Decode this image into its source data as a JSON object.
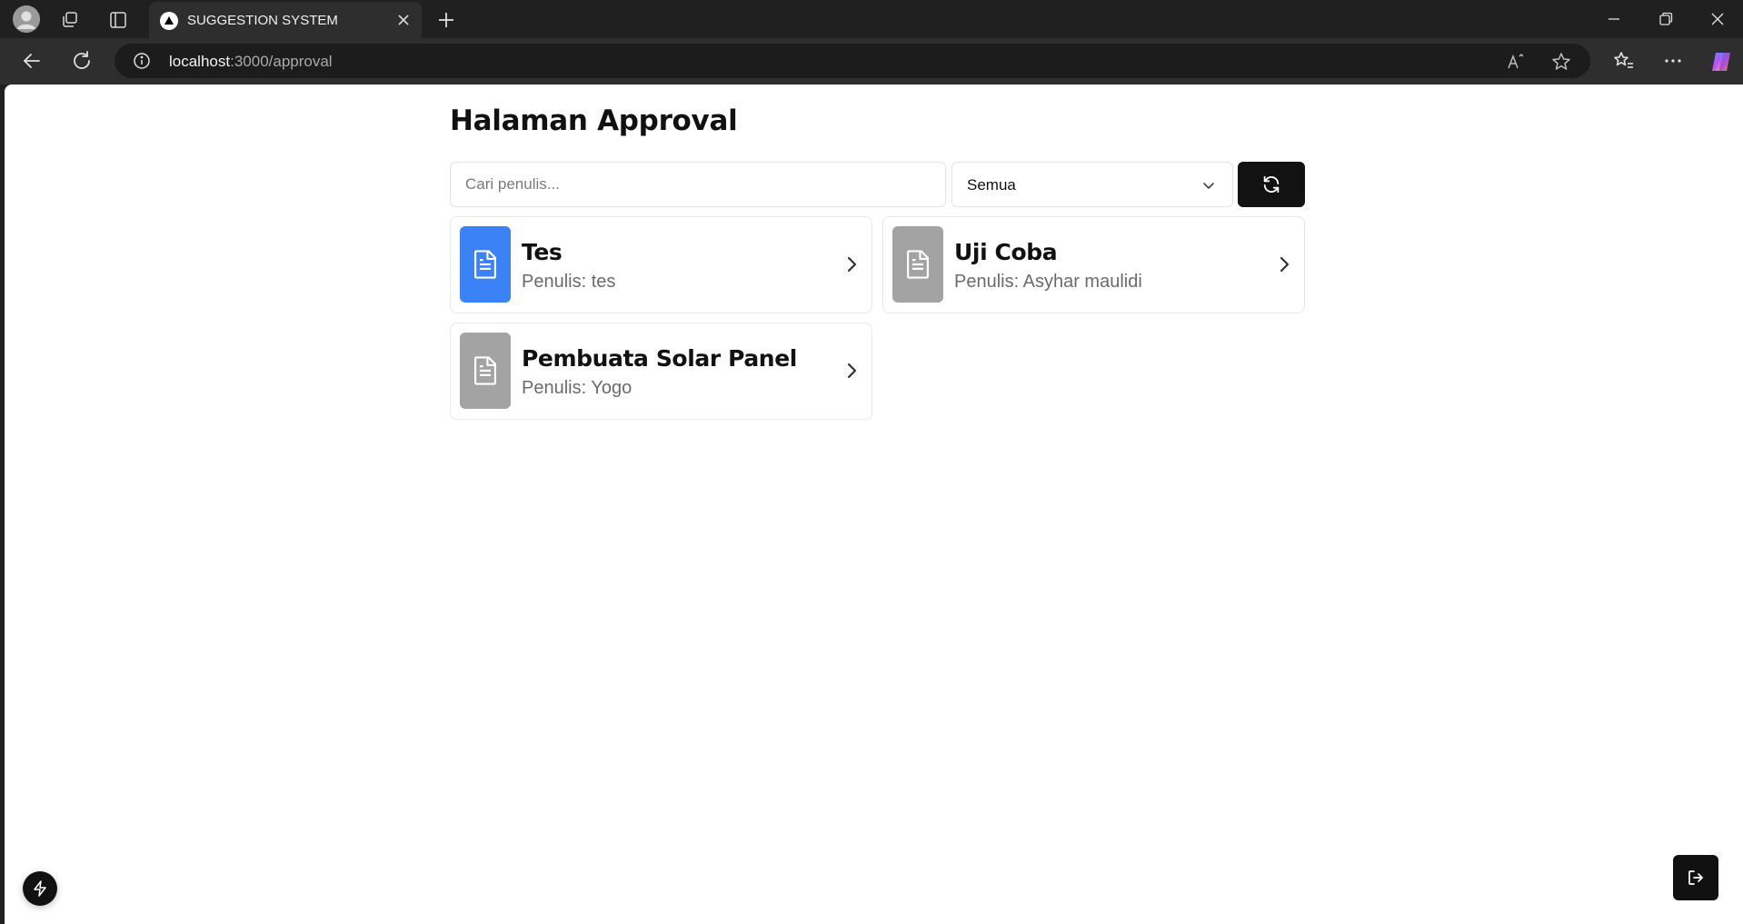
{
  "browser": {
    "tab_title": "SUGGESTION SYSTEM",
    "url_host": "localhost",
    "url_path": ":3000/approval"
  },
  "page": {
    "title": "Halaman Approval",
    "search": {
      "placeholder": "Cari penulis...",
      "value": ""
    },
    "filter": {
      "selected": "Semua"
    }
  },
  "cards": [
    {
      "title": "Tes",
      "author": "Penulis: tes",
      "tile_color": "#3b82f6"
    },
    {
      "title": "Uji Coba",
      "author": "Penulis: Asyhar maulidi",
      "tile_color": "#a3a3a3"
    },
    {
      "title": "Pembuata Solar Panel",
      "author": "Penulis: Yogo",
      "tile_color": "#a3a3a3"
    }
  ],
  "colors": {
    "accent_blue": "#3b82f6",
    "muted_gray": "#a3a3a3",
    "dark_button": "#121212"
  }
}
